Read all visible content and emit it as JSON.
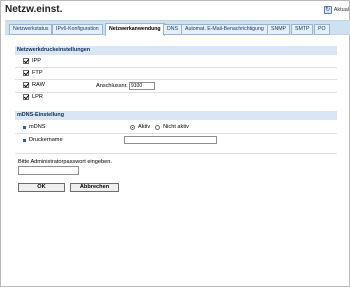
{
  "page": {
    "title": "Netzw.einst.",
    "refresh_label": "Aktual"
  },
  "tabs": [
    {
      "label": "Netzwerkstatus",
      "active": false
    },
    {
      "label": "IPv6-Konfiguration",
      "active": false
    },
    {
      "label": "Netzwerkanwendung",
      "active": true
    },
    {
      "label": "DNS",
      "active": false
    },
    {
      "label": "Automat. E-Mail-Benachrichtigung",
      "active": false
    },
    {
      "label": "SNMP",
      "active": false
    },
    {
      "label": "SMTP",
      "active": false
    },
    {
      "label": "PO",
      "active": false
    }
  ],
  "print_settings": {
    "heading": "Netzwerkdruckeinstellungen",
    "items": [
      {
        "label": "IPP",
        "checked": true
      },
      {
        "label": "FTP",
        "checked": true
      },
      {
        "label": "RAW",
        "checked": true
      },
      {
        "label": "LPR",
        "checked": true
      }
    ],
    "port_label": "Anschlussnr.",
    "port_value": "9100"
  },
  "mdns": {
    "heading": "mDNS-Einstellung",
    "mdns_label": "mDNS",
    "option_on": "Aktiv",
    "option_off": "Nicht aktiv",
    "selected": "Aktiv",
    "printer_name_label": "Druckername",
    "printer_name_value": ""
  },
  "admin": {
    "password_prompt": "Bitte Administratorpasswort eingeben.",
    "password_value": ""
  },
  "buttons": {
    "ok": "OK",
    "cancel": "Abbrechen"
  },
  "colors": {
    "tab_bar": "#cfe0f0",
    "section_bg": "#d9e6f3",
    "accent": "#2e5e9a"
  }
}
